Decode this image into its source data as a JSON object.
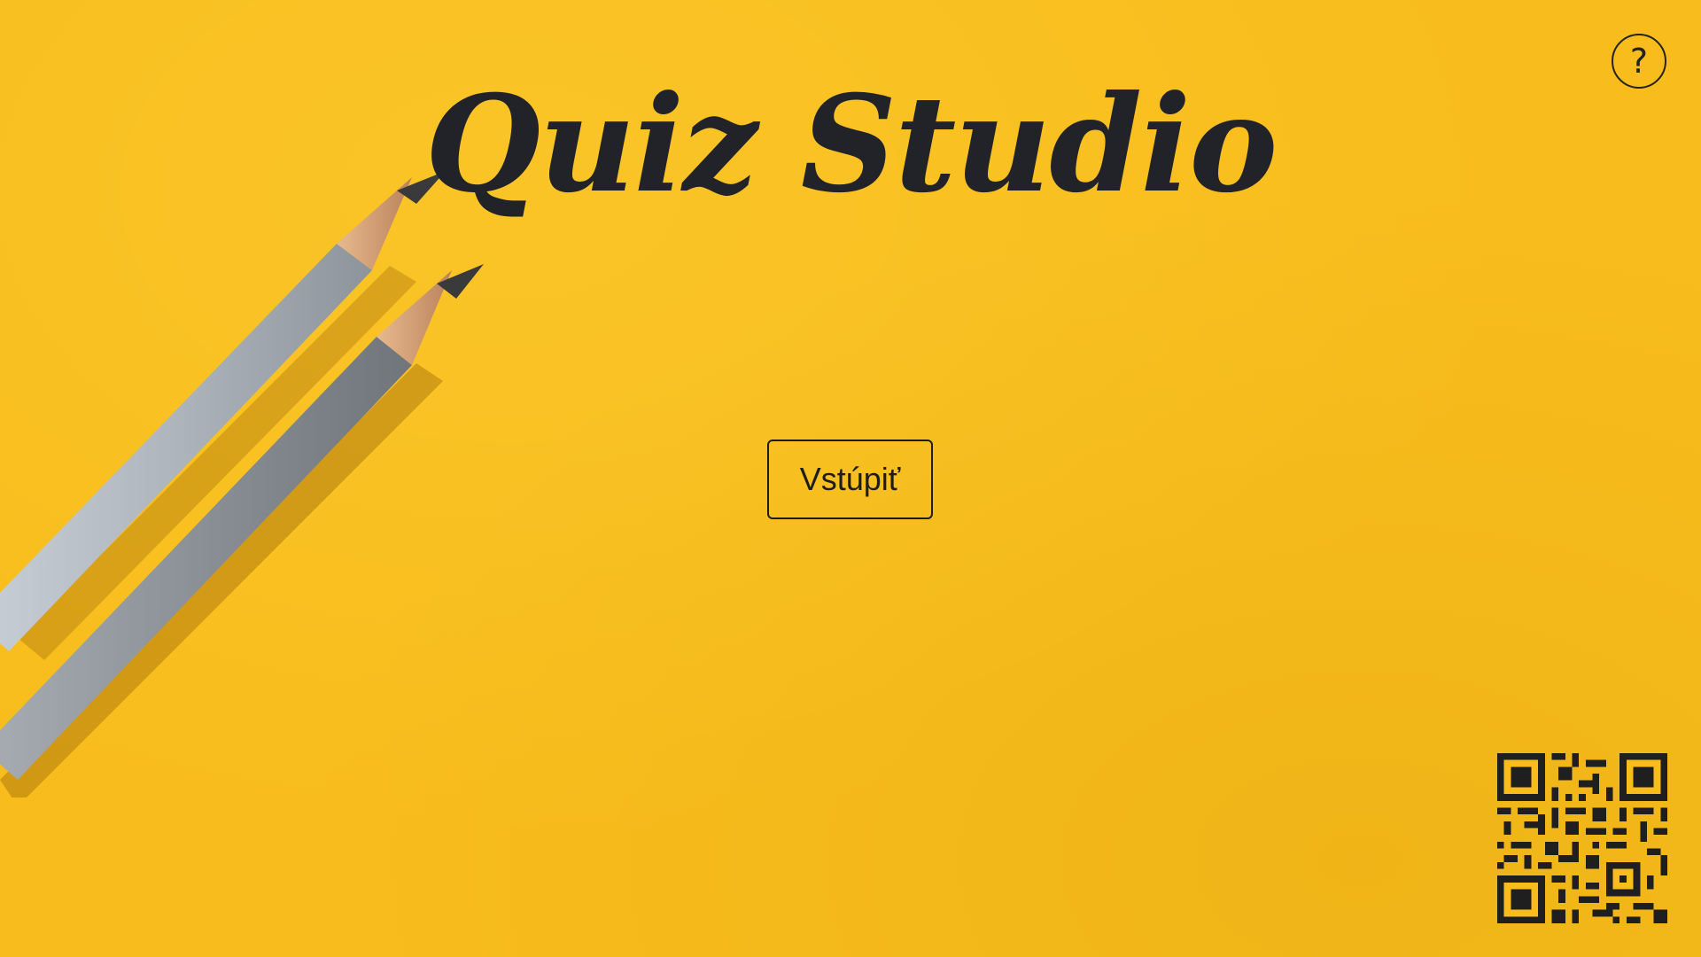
{
  "app": {
    "title": "Quiz Studio"
  },
  "actions": {
    "enter_label": "Vstúpiť",
    "help_icon": "question-mark-circle-icon",
    "help_glyph": "?"
  },
  "decor": {
    "background_image": "two-pencils-on-yellow-paper",
    "qr_code": "qr-code-image"
  },
  "colors": {
    "background": "#f8bd1c",
    "text": "#222328"
  }
}
